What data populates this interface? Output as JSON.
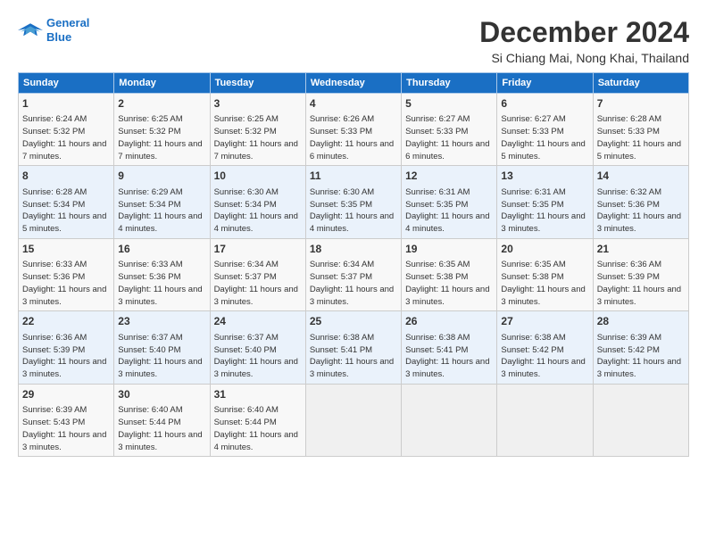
{
  "logo": {
    "line1": "General",
    "line2": "Blue"
  },
  "title": "December 2024",
  "location": "Si Chiang Mai, Nong Khai, Thailand",
  "headers": [
    "Sunday",
    "Monday",
    "Tuesday",
    "Wednesday",
    "Thursday",
    "Friday",
    "Saturday"
  ],
  "weeks": [
    [
      {
        "day": "1",
        "sunrise": "Sunrise: 6:24 AM",
        "sunset": "Sunset: 5:32 PM",
        "daylight": "Daylight: 11 hours and 7 minutes."
      },
      {
        "day": "2",
        "sunrise": "Sunrise: 6:25 AM",
        "sunset": "Sunset: 5:32 PM",
        "daylight": "Daylight: 11 hours and 7 minutes."
      },
      {
        "day": "3",
        "sunrise": "Sunrise: 6:25 AM",
        "sunset": "Sunset: 5:32 PM",
        "daylight": "Daylight: 11 hours and 7 minutes."
      },
      {
        "day": "4",
        "sunrise": "Sunrise: 6:26 AM",
        "sunset": "Sunset: 5:33 PM",
        "daylight": "Daylight: 11 hours and 6 minutes."
      },
      {
        "day": "5",
        "sunrise": "Sunrise: 6:27 AM",
        "sunset": "Sunset: 5:33 PM",
        "daylight": "Daylight: 11 hours and 6 minutes."
      },
      {
        "day": "6",
        "sunrise": "Sunrise: 6:27 AM",
        "sunset": "Sunset: 5:33 PM",
        "daylight": "Daylight: 11 hours and 5 minutes."
      },
      {
        "day": "7",
        "sunrise": "Sunrise: 6:28 AM",
        "sunset": "Sunset: 5:33 PM",
        "daylight": "Daylight: 11 hours and 5 minutes."
      }
    ],
    [
      {
        "day": "8",
        "sunrise": "Sunrise: 6:28 AM",
        "sunset": "Sunset: 5:34 PM",
        "daylight": "Daylight: 11 hours and 5 minutes."
      },
      {
        "day": "9",
        "sunrise": "Sunrise: 6:29 AM",
        "sunset": "Sunset: 5:34 PM",
        "daylight": "Daylight: 11 hours and 4 minutes."
      },
      {
        "day": "10",
        "sunrise": "Sunrise: 6:30 AM",
        "sunset": "Sunset: 5:34 PM",
        "daylight": "Daylight: 11 hours and 4 minutes."
      },
      {
        "day": "11",
        "sunrise": "Sunrise: 6:30 AM",
        "sunset": "Sunset: 5:35 PM",
        "daylight": "Daylight: 11 hours and 4 minutes."
      },
      {
        "day": "12",
        "sunrise": "Sunrise: 6:31 AM",
        "sunset": "Sunset: 5:35 PM",
        "daylight": "Daylight: 11 hours and 4 minutes."
      },
      {
        "day": "13",
        "sunrise": "Sunrise: 6:31 AM",
        "sunset": "Sunset: 5:35 PM",
        "daylight": "Daylight: 11 hours and 3 minutes."
      },
      {
        "day": "14",
        "sunrise": "Sunrise: 6:32 AM",
        "sunset": "Sunset: 5:36 PM",
        "daylight": "Daylight: 11 hours and 3 minutes."
      }
    ],
    [
      {
        "day": "15",
        "sunrise": "Sunrise: 6:33 AM",
        "sunset": "Sunset: 5:36 PM",
        "daylight": "Daylight: 11 hours and 3 minutes."
      },
      {
        "day": "16",
        "sunrise": "Sunrise: 6:33 AM",
        "sunset": "Sunset: 5:36 PM",
        "daylight": "Daylight: 11 hours and 3 minutes."
      },
      {
        "day": "17",
        "sunrise": "Sunrise: 6:34 AM",
        "sunset": "Sunset: 5:37 PM",
        "daylight": "Daylight: 11 hours and 3 minutes."
      },
      {
        "day": "18",
        "sunrise": "Sunrise: 6:34 AM",
        "sunset": "Sunset: 5:37 PM",
        "daylight": "Daylight: 11 hours and 3 minutes."
      },
      {
        "day": "19",
        "sunrise": "Sunrise: 6:35 AM",
        "sunset": "Sunset: 5:38 PM",
        "daylight": "Daylight: 11 hours and 3 minutes."
      },
      {
        "day": "20",
        "sunrise": "Sunrise: 6:35 AM",
        "sunset": "Sunset: 5:38 PM",
        "daylight": "Daylight: 11 hours and 3 minutes."
      },
      {
        "day": "21",
        "sunrise": "Sunrise: 6:36 AM",
        "sunset": "Sunset: 5:39 PM",
        "daylight": "Daylight: 11 hours and 3 minutes."
      }
    ],
    [
      {
        "day": "22",
        "sunrise": "Sunrise: 6:36 AM",
        "sunset": "Sunset: 5:39 PM",
        "daylight": "Daylight: 11 hours and 3 minutes."
      },
      {
        "day": "23",
        "sunrise": "Sunrise: 6:37 AM",
        "sunset": "Sunset: 5:40 PM",
        "daylight": "Daylight: 11 hours and 3 minutes."
      },
      {
        "day": "24",
        "sunrise": "Sunrise: 6:37 AM",
        "sunset": "Sunset: 5:40 PM",
        "daylight": "Daylight: 11 hours and 3 minutes."
      },
      {
        "day": "25",
        "sunrise": "Sunrise: 6:38 AM",
        "sunset": "Sunset: 5:41 PM",
        "daylight": "Daylight: 11 hours and 3 minutes."
      },
      {
        "day": "26",
        "sunrise": "Sunrise: 6:38 AM",
        "sunset": "Sunset: 5:41 PM",
        "daylight": "Daylight: 11 hours and 3 minutes."
      },
      {
        "day": "27",
        "sunrise": "Sunrise: 6:38 AM",
        "sunset": "Sunset: 5:42 PM",
        "daylight": "Daylight: 11 hours and 3 minutes."
      },
      {
        "day": "28",
        "sunrise": "Sunrise: 6:39 AM",
        "sunset": "Sunset: 5:42 PM",
        "daylight": "Daylight: 11 hours and 3 minutes."
      }
    ],
    [
      {
        "day": "29",
        "sunrise": "Sunrise: 6:39 AM",
        "sunset": "Sunset: 5:43 PM",
        "daylight": "Daylight: 11 hours and 3 minutes."
      },
      {
        "day": "30",
        "sunrise": "Sunrise: 6:40 AM",
        "sunset": "Sunset: 5:44 PM",
        "daylight": "Daylight: 11 hours and 3 minutes."
      },
      {
        "day": "31",
        "sunrise": "Sunrise: 6:40 AM",
        "sunset": "Sunset: 5:44 PM",
        "daylight": "Daylight: 11 hours and 4 minutes."
      },
      null,
      null,
      null,
      null
    ]
  ]
}
